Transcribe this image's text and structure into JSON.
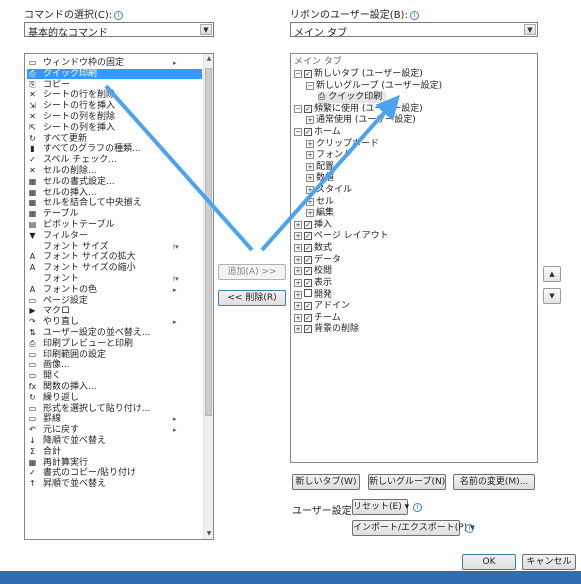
{
  "left": {
    "label": "コマンドの選択(C):",
    "combo_value": "基本的なコマンド",
    "commands": [
      {
        "icon": "▭",
        "label": "ウィンドウ枠の固定",
        "sub": "▸"
      },
      {
        "icon": "⎙",
        "label": "クイック印刷",
        "sub": "",
        "selected": true
      },
      {
        "icon": "⎘",
        "label": "コピー",
        "sub": ""
      },
      {
        "icon": "✕",
        "label": "シートの行を削除",
        "sub": ""
      },
      {
        "icon": "⇲",
        "label": "シートの行を挿入",
        "sub": ""
      },
      {
        "icon": "✕",
        "label": "シートの列を削除",
        "sub": ""
      },
      {
        "icon": "⇱",
        "label": "シートの列を挿入",
        "sub": ""
      },
      {
        "icon": "↻",
        "label": "すべて更新",
        "sub": ""
      },
      {
        "icon": "▮",
        "label": "すべてのグラフの種類...",
        "sub": ""
      },
      {
        "icon": "✓",
        "label": "スペル チェック...",
        "sub": ""
      },
      {
        "icon": "✕",
        "label": "セルの削除...",
        "sub": ""
      },
      {
        "icon": "▦",
        "label": "セルの書式設定...",
        "sub": ""
      },
      {
        "icon": "▦",
        "label": "セルの挿入...",
        "sub": ""
      },
      {
        "icon": "▦",
        "label": "セルを結合して中央揃え",
        "sub": ""
      },
      {
        "icon": "▦",
        "label": "テーブル",
        "sub": ""
      },
      {
        "icon": "▤",
        "label": "ピボットテーブル",
        "sub": ""
      },
      {
        "icon": "▼",
        "label": "フィルター",
        "sub": ""
      },
      {
        "icon": "",
        "label": "フォント サイズ",
        "sub": "I▾"
      },
      {
        "icon": "A",
        "label": "フォント サイズの拡大",
        "sub": ""
      },
      {
        "icon": "A",
        "label": "フォント サイズの縮小",
        "sub": ""
      },
      {
        "icon": "",
        "label": "フォント",
        "sub": "I▾"
      },
      {
        "icon": "A",
        "label": "フォントの色",
        "sub": "▸"
      },
      {
        "icon": "▭",
        "label": "ページ設定",
        "sub": ""
      },
      {
        "icon": "▶",
        "label": "マクロ",
        "sub": ""
      },
      {
        "icon": "↷",
        "label": "やり直し",
        "sub": "▸"
      },
      {
        "icon": "⇅",
        "label": "ユーザー設定の並べ替え...",
        "sub": ""
      },
      {
        "icon": "⎙",
        "label": "印刷プレビューと印刷",
        "sub": ""
      },
      {
        "icon": "▭",
        "label": "印刷範囲の設定",
        "sub": ""
      },
      {
        "icon": "▭",
        "label": "画像...",
        "sub": ""
      },
      {
        "icon": "▭",
        "label": "開く",
        "sub": ""
      },
      {
        "icon": "fx",
        "label": "関数の挿入...",
        "sub": ""
      },
      {
        "icon": "↻",
        "label": "繰り返し",
        "sub": ""
      },
      {
        "icon": "▭",
        "label": "形式を選択して貼り付け...",
        "sub": ""
      },
      {
        "icon": "▭",
        "label": "罫線",
        "sub": "▸"
      },
      {
        "icon": "↶",
        "label": "元に戻す",
        "sub": "▸"
      },
      {
        "icon": "↓",
        "label": "降順で並べ替え",
        "sub": ""
      },
      {
        "icon": "Σ",
        "label": "合計",
        "sub": ""
      },
      {
        "icon": "▦",
        "label": "再計算実行",
        "sub": ""
      },
      {
        "icon": "✓",
        "label": "書式のコピー/貼り付け",
        "sub": ""
      },
      {
        "icon": "↑",
        "label": "昇順で並べ替え",
        "sub": ""
      }
    ]
  },
  "right": {
    "label": "リボンのユーザー設定(B):",
    "combo_value": "メイン タブ",
    "tree_header": "メイン タブ",
    "tree": [
      {
        "indent": 0,
        "exp": "⊟",
        "chk": "✓",
        "label": "新しいタブ (ユーザー設定)"
      },
      {
        "indent": 1,
        "exp": "⊟",
        "chk": "",
        "label": "新しいグループ (ユーザー設定)"
      },
      {
        "indent": 2,
        "exp": "",
        "chk": "",
        "label": "クイック印刷",
        "icon": "⎙"
      },
      {
        "indent": 0,
        "exp": "⊟",
        "chk": "✓",
        "label": "頻繁に使用 (ユーザー設定)"
      },
      {
        "indent": 1,
        "exp": "⊞",
        "chk": "",
        "label": "通常使用 (ユーザー設定)"
      },
      {
        "indent": 0,
        "exp": "⊟",
        "chk": "✓",
        "label": "ホーム"
      },
      {
        "indent": 1,
        "exp": "⊞",
        "chk": "",
        "label": "クリップボード"
      },
      {
        "indent": 1,
        "exp": "⊞",
        "chk": "",
        "label": "フォント"
      },
      {
        "indent": 1,
        "exp": "⊞",
        "chk": "",
        "label": "配置"
      },
      {
        "indent": 1,
        "exp": "⊞",
        "chk": "",
        "label": "数値"
      },
      {
        "indent": 1,
        "exp": "⊞",
        "chk": "",
        "label": "スタイル"
      },
      {
        "indent": 1,
        "exp": "⊞",
        "chk": "",
        "label": "セル"
      },
      {
        "indent": 1,
        "exp": "⊞",
        "chk": "",
        "label": "編集"
      },
      {
        "indent": 0,
        "exp": "⊞",
        "chk": "✓",
        "label": "挿入"
      },
      {
        "indent": 0,
        "exp": "⊞",
        "chk": "✓",
        "label": "ページ レイアウト"
      },
      {
        "indent": 0,
        "exp": "⊞",
        "chk": "✓",
        "label": "数式"
      },
      {
        "indent": 0,
        "exp": "⊞",
        "chk": "✓",
        "label": "データ"
      },
      {
        "indent": 0,
        "exp": "⊞",
        "chk": "✓",
        "label": "校閲"
      },
      {
        "indent": 0,
        "exp": "⊞",
        "chk": "✓",
        "label": "表示"
      },
      {
        "indent": 0,
        "exp": "⊞",
        "chk": "",
        "label": "開発"
      },
      {
        "indent": 0,
        "exp": "⊞",
        "chk": "✓",
        "label": "アドイン"
      },
      {
        "indent": 0,
        "exp": "⊞",
        "chk": "✓",
        "label": "チーム"
      },
      {
        "indent": 0,
        "exp": "⊞",
        "chk": "✓",
        "label": "背景の削除"
      }
    ],
    "new_tab_button": "新しいタブ(W)",
    "new_group_button": "新しいグループ(N)",
    "rename_button": "名前の変更(M)...",
    "customize_label": "ユーザー設定:",
    "reset_button": "リセット(E) ▾",
    "import_export_button": "インポート/エクスポート(P) ▾"
  },
  "middle": {
    "add_button": "追加(A) >>",
    "remove_button": "<< 削除(R)"
  },
  "footer": {
    "ok_button": "OK",
    "cancel_button": "キャンセル"
  },
  "colors": {
    "selection": "#3399ff",
    "annotation_arrow": "#4da3f0",
    "taskbar": "#2f6fb1"
  }
}
